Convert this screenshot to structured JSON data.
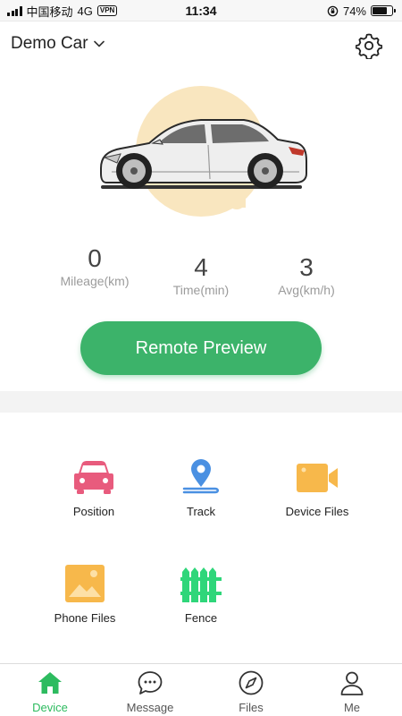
{
  "status_bar": {
    "carrier": "中国移动",
    "network": "4G",
    "vpn": "VPN",
    "time": "11:34",
    "battery": "74%",
    "battery_level": 0.74
  },
  "header": {
    "car_name": "Demo Car",
    "settings_icon": "gear-icon"
  },
  "stats": [
    {
      "value": "0",
      "label": "Mileage(km)"
    },
    {
      "value": "4",
      "label": "Time(min)"
    },
    {
      "value": "3",
      "label": "Avg(km/h)"
    }
  ],
  "remote_button": "Remote Preview",
  "features": [
    {
      "label": "Position",
      "icon": "car-icon",
      "color": "#e85b7d"
    },
    {
      "label": "Track",
      "icon": "location-pin-icon",
      "color": "#4a90e2"
    },
    {
      "label": "Device Files",
      "icon": "video-camera-icon",
      "color": "#f7b84b"
    },
    {
      "label": "Phone Files",
      "icon": "image-icon",
      "color": "#f7b84b"
    },
    {
      "label": "Fence",
      "icon": "fence-icon",
      "color": "#2fd67a"
    }
  ],
  "tabs": [
    {
      "label": "Device",
      "icon": "home-icon",
      "active": true
    },
    {
      "label": "Message",
      "icon": "chat-bubble-icon",
      "active": false
    },
    {
      "label": "Files",
      "icon": "compass-icon",
      "active": false
    },
    {
      "label": "Me",
      "icon": "person-icon",
      "active": false
    }
  ],
  "colors": {
    "accent": "#3cb36a",
    "active_tab": "#2dbb5f",
    "hero_circle": "#f9e6bf"
  }
}
